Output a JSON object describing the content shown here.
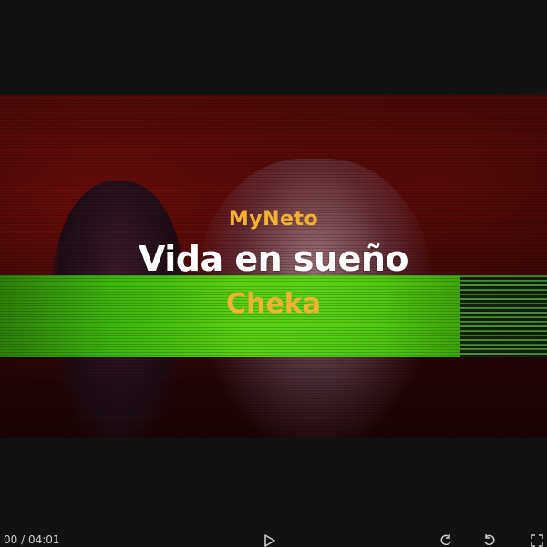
{
  "video": {
    "artist": "MyNeto",
    "song_title": "Vida en sueño",
    "featuring": "Cheka"
  },
  "controls": {
    "time_display": "00 / 04:01",
    "icons": [
      "play-icon",
      "rewind-icon",
      "forward-icon",
      "fullscreen-icon"
    ]
  },
  "colors": {
    "title_accent": "#f2b233",
    "title_main": "#ffffff",
    "band_green": "#4fd40c",
    "background_red": "#3a0808"
  }
}
